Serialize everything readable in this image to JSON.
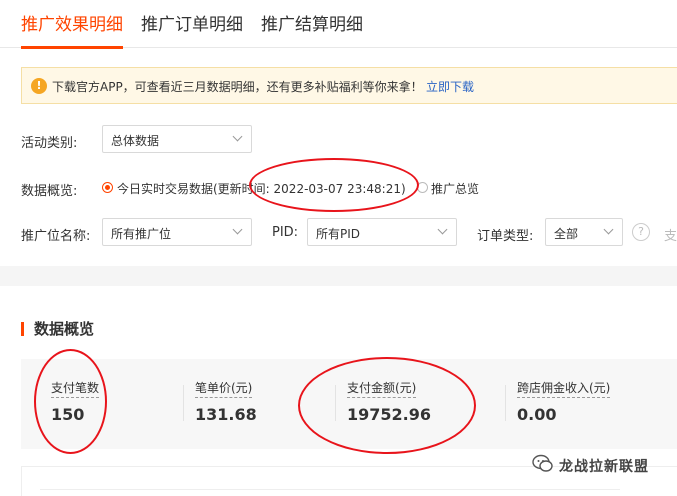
{
  "tabs": [
    {
      "label": "推广效果明细",
      "active": true
    },
    {
      "label": "推广订单明细",
      "active": false
    },
    {
      "label": "推广结算明细",
      "active": false
    }
  ],
  "notice": {
    "icon": "exclamation-icon",
    "text": "下载官方APP，可查看近三月数据明细，还有更多补贴福利等你来拿！",
    "link": "立即下载"
  },
  "filters": {
    "activity_type_label": "活动类别:",
    "activity_type_value": "总体数据",
    "overview_label": "数据概览:",
    "radio_realtime": "今日实时交易数据(更新时间: 2022-03-07 23:48:21)",
    "radio_summary": "推广总览",
    "position_label": "推广位名称:",
    "position_value": "所有推广位",
    "pid_label": "PID:",
    "pid_value": "所有PID",
    "order_type_label": "订单类型:",
    "order_type_value": "全部",
    "help_icon": "?",
    "truncated_text": "支"
  },
  "overview": {
    "title": "数据概览",
    "metrics": [
      {
        "label": "支付笔数",
        "value": "150"
      },
      {
        "label": "笔单价(元)",
        "value": "131.68"
      },
      {
        "label": "支付金额(元)",
        "value": "19752.96"
      },
      {
        "label": "跨店佣金收入(元)",
        "value": "0.00"
      }
    ]
  },
  "watermark": {
    "text": "龙战拉新联盟",
    "icon": "wechat-icon"
  },
  "colors": {
    "accent": "#ff4400",
    "link": "#2a64c5",
    "annotation": "#e8141b",
    "notice_bg": "#fff8e6"
  }
}
